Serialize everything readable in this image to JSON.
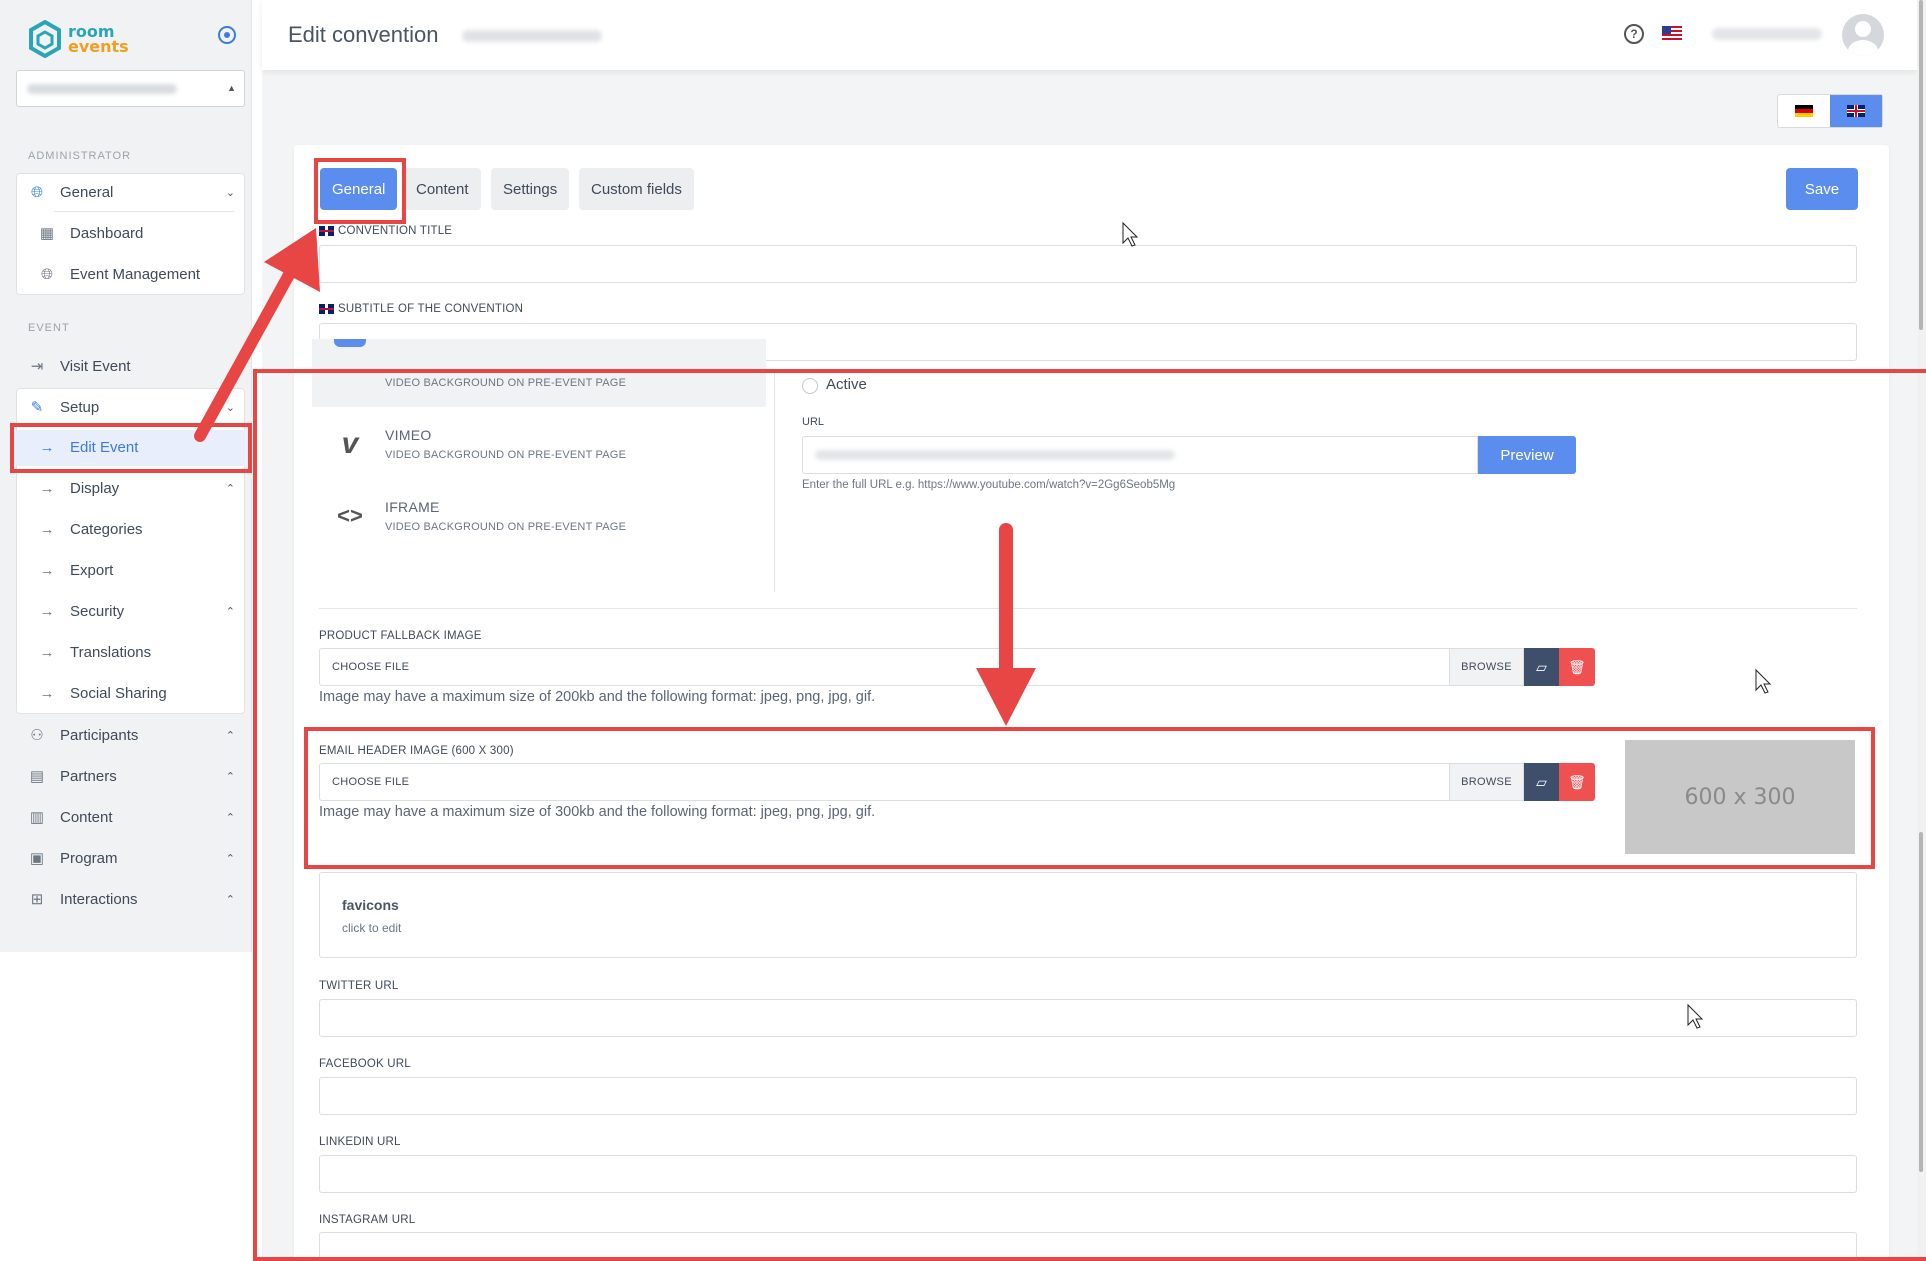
{
  "sidebar": {
    "logo": {
      "line1": "room",
      "line2": "events"
    },
    "admin_section": "ADMINISTRATOR",
    "event_section": "EVENT",
    "items": {
      "general": "General",
      "dashboard": "Dashboard",
      "event_management": "Event Management",
      "visit_event": "Visit Event",
      "setup": "Setup",
      "edit_event": "Edit Event",
      "display": "Display",
      "categories": "Categories",
      "export": "Export",
      "security": "Security",
      "translations": "Translations",
      "social_sharing": "Social Sharing",
      "participants": "Participants",
      "partners": "Partners",
      "content": "Content",
      "program": "Program",
      "interactions": "Interactions"
    }
  },
  "header": {
    "title": "Edit convention",
    "help_symbol": "?"
  },
  "tabs": {
    "general": "General",
    "content": "Content",
    "settings": "Settings",
    "custom_fields": "Custom fields"
  },
  "save_label": "Save",
  "fields": {
    "convention_title": "CONVENTION TITLE",
    "subtitle": "SUBTITLE OF THE CONVENTION",
    "twitter": "TWITTER URL",
    "facebook": "FACEBOOK URL",
    "linkedin": "LINKEDIN URL",
    "instagram": "INSTAGRAM URL"
  },
  "video": {
    "item_desc": "VIDEO BACKGROUND ON PRE-EVENT PAGE",
    "vimeo": "VIMEO",
    "iframe": "IFRAME",
    "active_label": "Active",
    "url_label": "URL",
    "preview": "Preview",
    "url_help": "Enter the full URL e.g. https://www.youtube.com/watch?v=2Gg6Seob5Mg"
  },
  "product_fallback": {
    "label": "PRODUCT FALLBACK IMAGE",
    "choose": "CHOOSE FILE",
    "browse": "BROWSE",
    "help": "Image may have a maximum size of 200kb and the following format: jpeg, png, jpg, gif."
  },
  "email_header": {
    "label": "EMAIL HEADER IMAGE (600 X 300)",
    "choose": "CHOOSE FILE",
    "browse": "BROWSE",
    "help": "Image may have a maximum size of 300kb and the following format: jpeg, png, jpg, gif.",
    "placeholder": "600 x 300"
  },
  "favicons": {
    "title": "favicons",
    "sub": "click to edit"
  },
  "colors": {
    "accent": "#5a8dee",
    "annotation": "#e84545",
    "danger": "#ef5050",
    "dark": "#3e4f6b"
  }
}
